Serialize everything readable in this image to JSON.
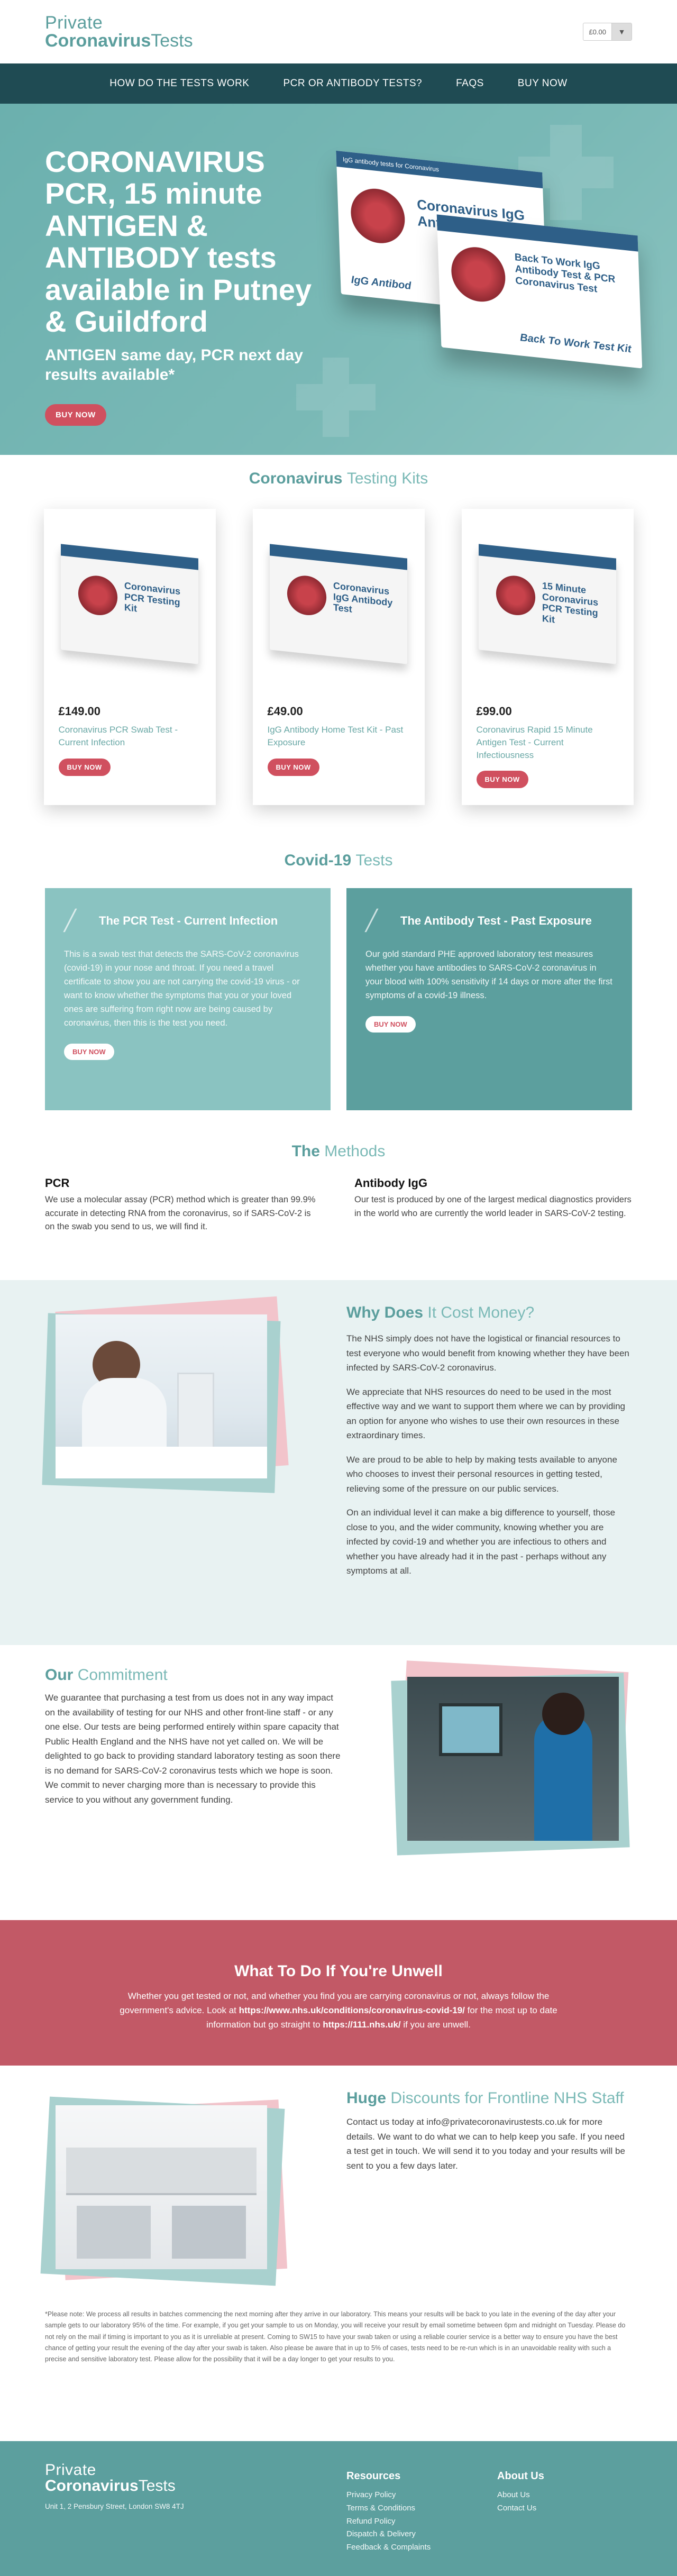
{
  "header": {
    "logo_line1": "Private",
    "logo_line2_bold": "Coronavirus",
    "logo_line2_rest": "Tests",
    "cart_amount": "£0.00",
    "cart_icon": "bag-icon"
  },
  "nav": {
    "items": [
      "HOW DO THE TESTS WORK",
      "PCR OR ANTIBODY TESTS?",
      "FAQS",
      "BUY NOW"
    ]
  },
  "hero": {
    "headline": "CORONAVIRUS PCR, 15 minute ANTIGEN & ANTIBODY tests available in Putney & Guildford",
    "subhead": "ANTIGEN same day, PCR next day results available*",
    "button": "BUY NOW",
    "box1_stripe": "IgG antibody tests for Coronavirus",
    "box1_title": "Coronavirus IgG Antibody Test",
    "box1_footer": "IgG Antibod",
    "box2_title": "Back To Work IgG Antibody Test & PCR Coronavirus Test",
    "box2_footer": "Back To Work Test Kit"
  },
  "kits": {
    "title_a": "Coronavirus",
    "title_b": "Testing Kits",
    "items": [
      {
        "price": "£149.00",
        "name": "Coronavirus PCR Swab Test - Current Infection",
        "button": "BUY NOW",
        "box_title": "Coronavirus PCR Testing Kit"
      },
      {
        "price": "£49.00",
        "name": "IgG Antibody Home Test Kit - Past Exposure",
        "button": "BUY NOW",
        "box_title": "Coronavirus IgG Antibody Test"
      },
      {
        "price": "£99.00",
        "name": "Coronavirus Rapid 15 Minute Antigen Test - Current Infectiousness",
        "button": "BUY NOW",
        "box_title": "15 Minute Coronavirus PCR Testing Kit"
      }
    ]
  },
  "covid": {
    "title_a": "Covid-19",
    "title_b": "Tests",
    "pcr": {
      "title": "The PCR Test - Current Infection",
      "body": "This is a swab test that detects the SARS-CoV-2 coronavirus (covid-19) in your nose and throat. If you need a travel certificate to show you are not carrying the covid-19 virus - or want to know whether the symptoms that you or your loved ones are suffering from right now are being caused by coronavirus, then this is the test you need.",
      "button": "BUY NOW"
    },
    "antibody": {
      "title": "The Antibody Test - Past Exposure",
      "body": "Our gold standard PHE approved laboratory test measures whether you have antibodies to SARS-CoV-2 coronavirus in your blood with 100% sensitivity if 14 days or more after the first symptoms of a covid-19 illness.",
      "button": "BUY NOW"
    }
  },
  "methods": {
    "title_a": "The",
    "title_b": "Methods",
    "pcr_title": "PCR",
    "pcr_body": "We use a molecular assay (PCR) method which is greater than 99.9% accurate in detecting RNA from the coronavirus, so if SARS-CoV-2 is on the swab you send to us, we will find it.",
    "ab_title": "Antibody IgG",
    "ab_body": "Our test is produced by one of the largest medical diagnostics providers in the world who are currently the world leader in SARS-CoV-2 testing."
  },
  "why": {
    "title_a": "Why Does",
    "title_b": "It Cost Money?",
    "p1": "The NHS simply does not have the logistical or financial resources to test everyone who would benefit from knowing whether they have been infected by SARS-CoV-2 coronavirus.",
    "p2": "We appreciate that NHS resources do need to be used in the most effective way and we want to support them where we can by providing an option for anyone who wishes to use their own resources in these extraordinary times.",
    "p3": "We are proud to be able to help by making tests available to anyone who chooses to invest their personal resources in getting tested, relieving some of the pressure on our public services.",
    "p4": "On an individual level it can make a big difference to yourself, those close to you, and the wider community, knowing whether you are infected by covid-19 and whether you are infectious to others and whether you have already had it in the past - perhaps without any symptoms at all."
  },
  "commit": {
    "title_a": "Our",
    "title_b": "Commitment",
    "body": "We guarantee that purchasing a test from us does not in any way impact on the availability of testing for our NHS and other front-line staff - or any one else. Our tests are being performed entirely within spare capacity that Public Health England and the NHS have not yet called on. We will be delighted to go back to providing standard laboratory testing as soon there is no demand for SARS-CoV-2 coronavirus tests which we hope is soon. We commit to never charging more than is necessary to provide this service to you without any government funding."
  },
  "unwell": {
    "title": "What To Do If You're Unwell",
    "body_1": "Whether you get tested or not, and whether you find you are carrying coronavirus or not, always follow the government's advice. Look at ",
    "link_1": "https://www.nhs.uk/conditions/coronavirus-covid-19/",
    "body_2": " for the most up to date information but go straight to ",
    "link_2": "https://111.nhs.uk/",
    "body_3": " if you are unwell."
  },
  "discounts": {
    "title_a": "Huge",
    "title_b": "Discounts for Frontline NHS Staff",
    "body": "Contact us today at info@privatecoronavirustests.co.uk for more details. We want to do what we can to help keep you safe. If you need a test get in touch. We will send it to you today and your results will be sent to you a few days later."
  },
  "note": {
    "body": "*Please note: We process all results in batches commencing the next morning after they arrive in our laboratory. This means your results will be back to you late in the evening of the day after your sample gets to our laboratory 95% of the time. For example, if you get your sample to us on Monday, you will receive your result by email sometime between 6pm and midnight on Tuesday. Please do not rely on the mail if timing is important to you as it is unreliable at present. Coming to SW15 to have your swab taken or using a reliable courier service is a better way to ensure you have the best chance of getting your result the evening of the day after your swab is taken. Also please be aware that in up to 5% of cases, tests need to be re-run which is in an unavoidable reality with such a precise and sensitive laboratory test. Please allow for the possibility that it will be a day longer to get your results to you."
  },
  "footer": {
    "logo_line1": "Private",
    "logo_line2_bold": "Coronavirus",
    "logo_line2_rest": "Tests",
    "address": "Unit 1, 2 Pensbury Street, London SW8 4TJ",
    "resources_title": "Resources",
    "resources": [
      "Privacy Policy",
      "Terms & Conditions",
      "Refund Policy",
      "Dispatch & Delivery",
      "Feedback & Complaints"
    ],
    "about_title": "About Us",
    "about": [
      "About Us",
      "Contact Us"
    ]
  },
  "colors": {
    "teal": "#5b9e9d",
    "light_teal": "#7ab9b6",
    "nav": "#1f4b53",
    "accent_red": "#d0505f",
    "unwell_bg": "#c25966"
  }
}
